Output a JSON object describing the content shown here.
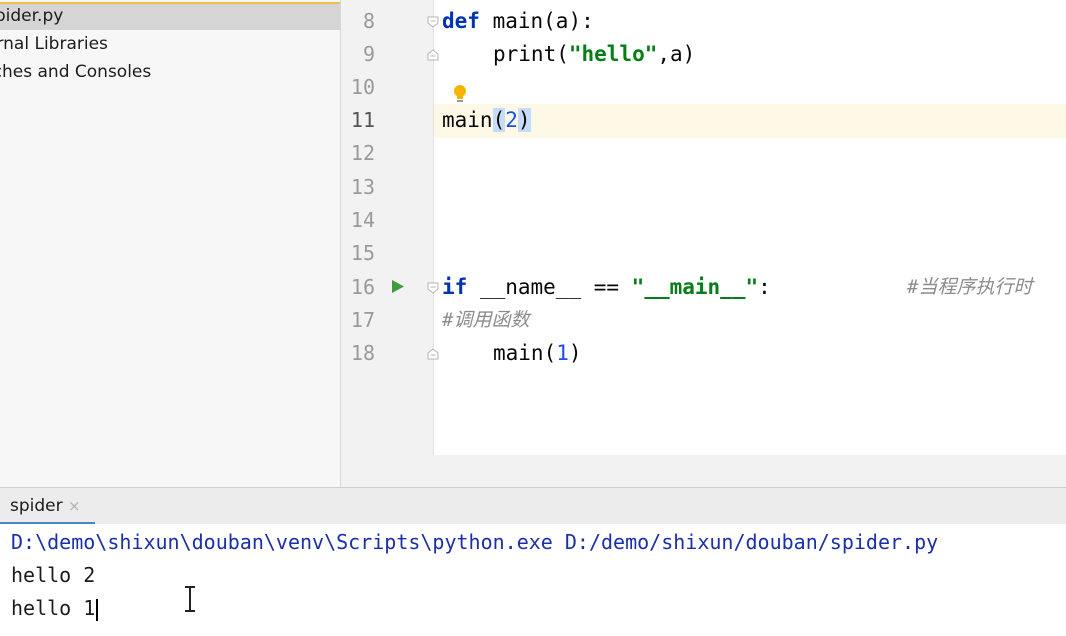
{
  "project_tree": {
    "items": [
      {
        "label": "spider.py",
        "selected": true
      },
      {
        "label": "ernal Libraries",
        "selected": false
      },
      {
        "label": "tches and Consoles",
        "selected": false
      }
    ]
  },
  "editor": {
    "line_numbers": [
      "8",
      "9",
      "10",
      "11",
      "12",
      "13",
      "14",
      "15",
      "16",
      "17",
      "18"
    ],
    "current_line": "11",
    "code": {
      "l8_kw": "def",
      "l8_rest": " main(a):",
      "l9_fn": "print(",
      "l9_str": "\"hello\"",
      "l9_rest": ",a)",
      "l11_fn": "main",
      "l11_open": "(",
      "l11_arg": "2",
      "l11_close": ")",
      "l16_kw": "if",
      "l16_mid": " __name__ == ",
      "l16_str": "\"__main__\"",
      "l16_colon": ":",
      "l16_comment": "#当程序执行时",
      "l17_comment": "#调用函数",
      "l18_fn": "main(",
      "l18_arg": "1",
      "l18_close": ")"
    }
  },
  "run_window": {
    "tab_label": "spider",
    "tab_close": "×",
    "lines": [
      "D:\\demo\\shixun\\douban\\venv\\Scripts\\python.exe D:/demo/shixun/douban/spider.py",
      "hello 2",
      "hello 1"
    ]
  },
  "colors": {
    "keyword": "#0033b3",
    "string": "#067d17",
    "number": "#1750eb",
    "comment": "#8c8c8c",
    "run_icon": "#3f9b3f",
    "current_line_bg": "#fdf9e6"
  },
  "icons": [
    "run-icon",
    "lightbulb-icon",
    "fold-icon",
    "text-cursor-icon"
  ]
}
